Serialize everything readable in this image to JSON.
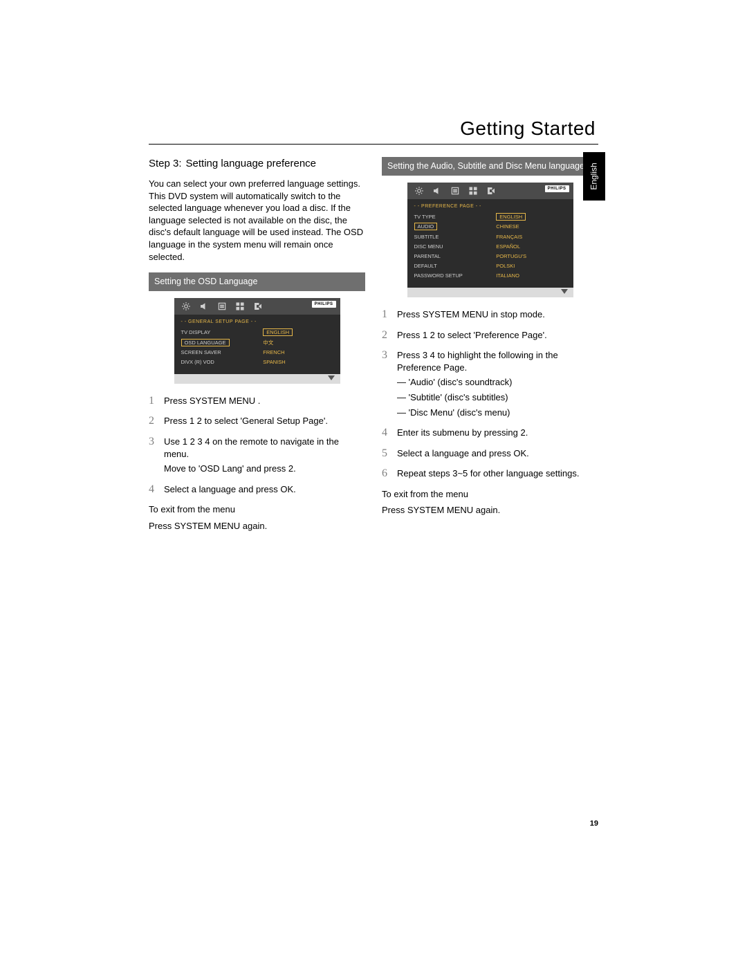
{
  "header": {
    "title": "Getting Started"
  },
  "sidetab": "English",
  "left": {
    "step_label": "Step 3:",
    "step_title": "Setting language preference",
    "intro": "You can select your own preferred language settings. This DVD system will automatically switch to the selected language whenever you load a disc. If the language selected is not available on the disc, the disc's default language will be used instead. The OSD language in the system menu will remain once selected.",
    "section": "Setting the OSD Language",
    "menu": {
      "title": "- - GENERAL SETUP PAGE - -",
      "brand": "PHILIPS",
      "left_items": [
        "TV DISPLAY",
        "OSD LANGUAGE",
        "SCREEN SAVER",
        "DIVX (R) VOD"
      ],
      "right_items": [
        "ENGLISH",
        "中文",
        "FRENCH",
        "SPANISH"
      ],
      "left_boxed_index": 1,
      "right_boxed_index": 0
    },
    "steps": [
      {
        "n": "1",
        "text": "Press SYSTEM MENU ."
      },
      {
        "n": "2",
        "text": "Press 1 2  to select 'General Setup Page'."
      },
      {
        "n": "3",
        "text": "Use 1 2 3 4     on the remote to navigate in the menu.",
        "extra": "Move to 'OSD Lang' and press 2."
      },
      {
        "n": "4",
        "text": "Select a language and press OK."
      }
    ],
    "exit1": "To exit from the menu",
    "exit2": "Press SYSTEM MENU  again."
  },
  "right": {
    "section": "Setting the Audio, Subtitle and Disc Menu language",
    "menu": {
      "title": "- - PREFERENCE PAGE - -",
      "brand": "PHILIPS",
      "left_items": [
        "TV TYPE",
        "AUDIO",
        "SUBTITLE",
        "DISC MENU",
        "PARENTAL",
        "DEFAULT",
        "PASSWORD SETUP"
      ],
      "right_items": [
        "ENGLISH",
        "CHINESE",
        "FRANÇAIS",
        "ESPAÑOL",
        "PORTUGU'S",
        "POLSKI",
        "ITALIANO"
      ],
      "left_boxed_index": 1,
      "right_boxed_index": 0
    },
    "steps": [
      {
        "n": "1",
        "text": "Press SYSTEM MENU  in stop mode."
      },
      {
        "n": "2",
        "text": "Press 1 2  to select 'Preference Page'."
      },
      {
        "n": "3",
        "text": "Press 3 4  to highlight the following in the Preference Page.",
        "bullets": [
          "—  'Audio' (disc's soundtrack)",
          "—  'Subtitle' (disc's subtitles)",
          "—  'Disc Menu' (disc's menu)"
        ]
      },
      {
        "n": "4",
        "text": "Enter its submenu by pressing 2."
      },
      {
        "n": "5",
        "text": "Select a language and press OK."
      },
      {
        "n": "6",
        "text": "Repeat steps 3~5 for other language settings."
      }
    ],
    "exit1": "To exit from the menu",
    "exit2": "Press SYSTEM MENU  again."
  },
  "page_number": "19"
}
